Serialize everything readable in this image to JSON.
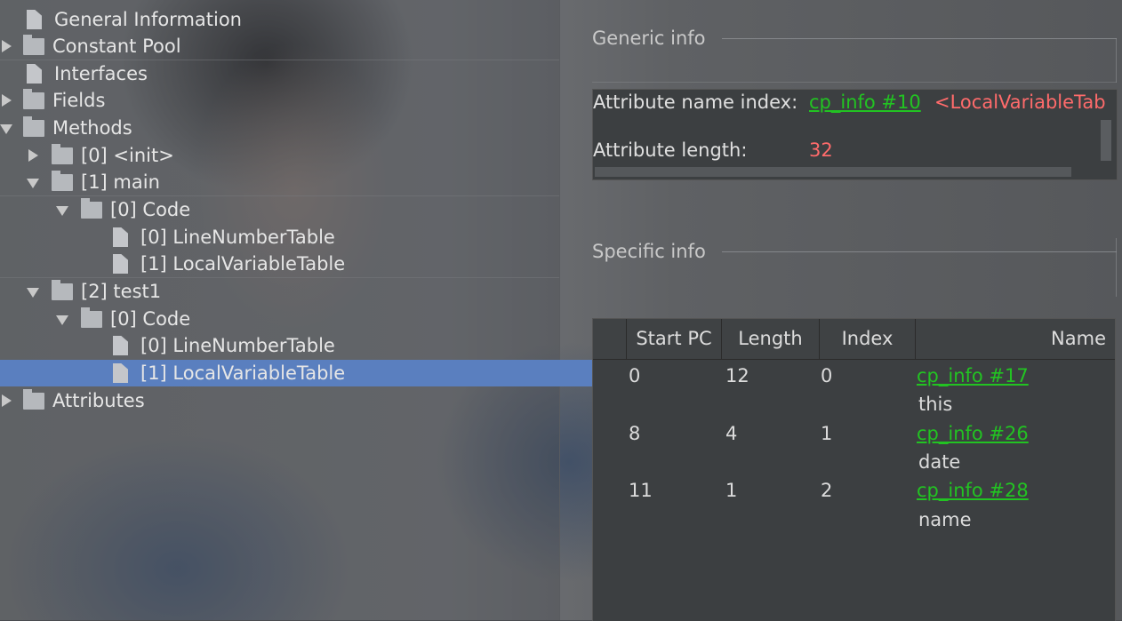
{
  "tree": {
    "items": [
      {
        "label": "General Information",
        "type": "file"
      },
      {
        "label": "Constant Pool",
        "type": "folder",
        "state": "collapsed"
      },
      {
        "label": "Interfaces",
        "type": "file"
      },
      {
        "label": "Fields",
        "type": "folder",
        "state": "collapsed"
      },
      {
        "label": "Methods",
        "type": "folder",
        "state": "expanded"
      },
      {
        "label": "[0] <init>",
        "type": "folder",
        "state": "collapsed"
      },
      {
        "label": "[1] main",
        "type": "folder",
        "state": "expanded"
      },
      {
        "label": "[0] Code",
        "type": "folder",
        "state": "expanded"
      },
      {
        "label": "[0] LineNumberTable",
        "type": "file"
      },
      {
        "label": "[1] LocalVariableTable",
        "type": "file"
      },
      {
        "label": "[2] test1",
        "type": "folder",
        "state": "expanded"
      },
      {
        "label": "[0] Code",
        "type": "folder",
        "state": "expanded"
      },
      {
        "label": "[0] LineNumberTable",
        "type": "file"
      },
      {
        "label": "[1] LocalVariableTable",
        "type": "file",
        "selected": true
      },
      {
        "label": "Attributes",
        "type": "folder",
        "state": "collapsed"
      }
    ]
  },
  "generic_info": {
    "title": "Generic info",
    "attr_name_index_label": "Attribute name index:",
    "attr_name_index_link": "cp_info #10",
    "attr_name_index_value": "<LocalVariableTab",
    "attr_length_label": "Attribute length:",
    "attr_length_value": "32"
  },
  "specific_info": {
    "title": "Specific info",
    "columns": [
      "Start PC",
      "Length",
      "Index",
      "Name"
    ],
    "rows": [
      {
        "start_pc": "0",
        "length": "12",
        "index": "0",
        "name_link": "cp_info #17",
        "name": "this"
      },
      {
        "start_pc": "8",
        "length": "4",
        "index": "1",
        "name_link": "cp_info #26",
        "name": "date"
      },
      {
        "start_pc": "11",
        "length": "1",
        "index": "2",
        "name_link": "cp_info #28",
        "name": "name"
      }
    ]
  },
  "colors": {
    "selection": "#5a7fbf",
    "link": "#22c322",
    "value_red": "#ff6b6b",
    "panel": "#3c3f41"
  }
}
